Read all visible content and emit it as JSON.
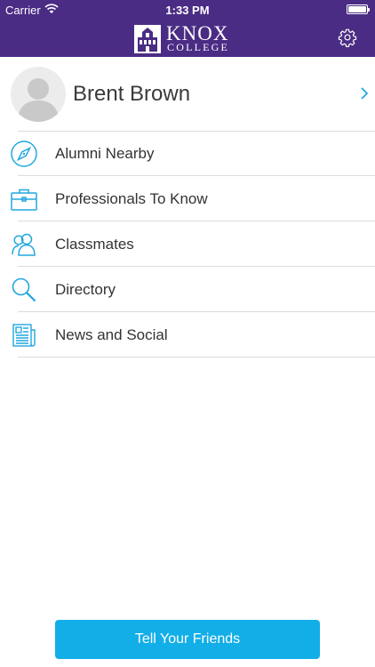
{
  "status_bar": {
    "carrier": "Carrier",
    "time": "1:33 PM"
  },
  "header": {
    "logo_main": "KNOX",
    "logo_sub": "COLLEGE",
    "settings_icon": "gear-icon",
    "background": "#4b2c84"
  },
  "profile": {
    "name": "Brent Brown",
    "avatar_icon": "person-silhouette-icon"
  },
  "menu": [
    {
      "label": "Alumni Nearby",
      "icon": "compass-icon"
    },
    {
      "label": "Professionals To Know",
      "icon": "briefcase-icon"
    },
    {
      "label": "Classmates",
      "icon": "people-icon"
    },
    {
      "label": "Directory",
      "icon": "magnifier-icon"
    },
    {
      "label": "News and Social",
      "icon": "newspaper-icon"
    }
  ],
  "cta": {
    "label": "Tell Your Friends",
    "background": "#12aee8"
  },
  "accent": "#22a7de"
}
